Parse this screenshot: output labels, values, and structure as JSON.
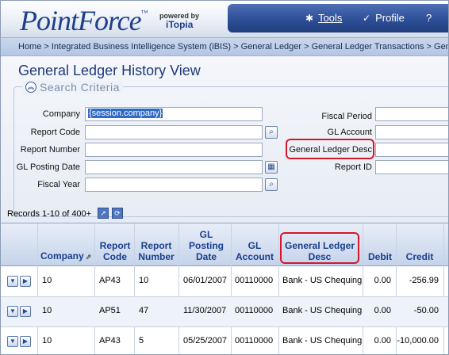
{
  "header": {
    "logo_text": "PointForce",
    "logo_tm": "™",
    "powered_by": "powered by",
    "brand": "iTopia",
    "nav": [
      {
        "label": "Tools",
        "icon": "tools-icon"
      },
      {
        "label": "Profile",
        "icon": "check-icon"
      },
      {
        "label": "?",
        "icon": "help-icon"
      }
    ]
  },
  "breadcrumb": "Home > Integrated Business Intelligence System (iBIS) > General Ledger > General Ledger Transactions > Gener",
  "page": {
    "title": "General Ledger History View",
    "section_title": "Search Criteria"
  },
  "search": {
    "company": {
      "label": "Company",
      "value": "{session.company}"
    },
    "report_code": {
      "label": "Report Code",
      "value": ""
    },
    "report_number": {
      "label": "Report Number",
      "value": ""
    },
    "gl_posting_date": {
      "label": "GL Posting Date",
      "value": ""
    },
    "fiscal_year": {
      "label": "Fiscal Year",
      "value": ""
    },
    "fiscal_period": {
      "label": "Fiscal Period",
      "value": ""
    },
    "gl_account": {
      "label": "GL Account",
      "value": ""
    },
    "gl_desc": {
      "label": "General Ledger Desc",
      "value": ""
    },
    "report_id": {
      "label": "Report ID",
      "value": ""
    }
  },
  "records": {
    "text": "Records 1-10 of 400+"
  },
  "grid": {
    "columns": {
      "company": "Company",
      "report_code": [
        "Report",
        "Code"
      ],
      "report_number": [
        "Report",
        "Number"
      ],
      "posting_date": [
        "GL",
        "Posting",
        "Date"
      ],
      "gl_account": [
        "GL",
        "Account"
      ],
      "gl_desc": [
        "General Ledger",
        "Desc"
      ],
      "debit": "Debit",
      "credit": "Credit"
    },
    "rows": [
      {
        "company": "10",
        "report_code": "AP43",
        "report_number": "10",
        "posting_date": "06/01/2007",
        "gl_account": "00110000",
        "gl_desc": "Bank - US Chequing",
        "debit": "0.00",
        "credit": "-256.99"
      },
      {
        "company": "10",
        "report_code": "AP51",
        "report_number": "47",
        "posting_date": "11/30/2007",
        "gl_account": "00110000",
        "gl_desc": "Bank - US Chequing",
        "debit": "0.00",
        "credit": "-50.00"
      },
      {
        "company": "10",
        "report_code": "AP43",
        "report_number": "5",
        "posting_date": "05/25/2007",
        "gl_account": "00110000",
        "gl_desc": "Bank - US Chequing",
        "debit": "0.00",
        "credit": "-10,000.00"
      }
    ]
  },
  "colors": {
    "brand_blue": "#1d3f8a",
    "highlight_red": "#d4182a",
    "selection_blue": "#316ac5"
  }
}
